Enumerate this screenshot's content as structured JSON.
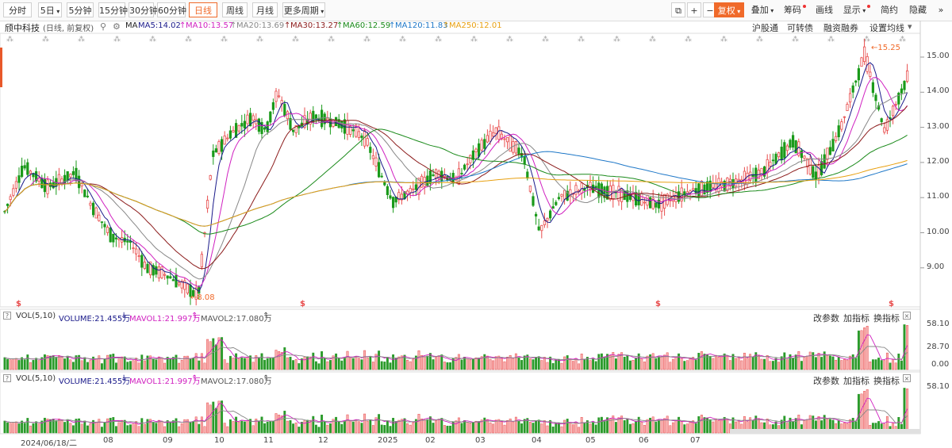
{
  "toolbar": {
    "periods": [
      {
        "label": "分时",
        "active": false
      },
      {
        "label": "5日",
        "active": false,
        "dropdown": true
      },
      {
        "label": "5分钟",
        "active": false
      },
      {
        "label": "15分钟",
        "active": false
      },
      {
        "label": "30分钟",
        "active": false
      },
      {
        "label": "60分钟",
        "active": false
      },
      {
        "label": "日线",
        "active": true
      },
      {
        "label": "周线",
        "active": false
      },
      {
        "label": "月线",
        "active": false
      },
      {
        "label": "更多周期",
        "active": false,
        "dropdown": true
      }
    ],
    "right_buttons": [
      {
        "label": "复权",
        "style": "orange",
        "dropdown": true
      },
      {
        "label": "叠加",
        "dropdown": true
      },
      {
        "label": "筹码",
        "dot": true
      },
      {
        "label": "画线"
      },
      {
        "label": "显示",
        "dropdown": true,
        "dot": true
      },
      {
        "label": "简约"
      },
      {
        "label": "隐藏"
      }
    ]
  },
  "header": {
    "stock_name": "颀中科技",
    "mode": "(日线, 前复权)",
    "ma_label": "MA",
    "ma": [
      {
        "label": "MA5:14.02",
        "color": "#1a1a8a"
      },
      {
        "label": "MA10:13.57",
        "color": "#d020c0"
      },
      {
        "label": "MA20:13.69",
        "color": "#888888"
      },
      {
        "label": "MA30:13.27",
        "color": "#8b1a1a"
      },
      {
        "label": "MA60:12.59",
        "color": "#1a8a1a"
      },
      {
        "label": "MA120:11.83",
        "color": "#1f78c8"
      },
      {
        "label": "MA250:12.01",
        "color": "#e8a010"
      }
    ],
    "links": [
      "沪股通",
      "可转债",
      "融资融券",
      "设置均线"
    ]
  },
  "price_axis": [
    "15.00",
    "14.00",
    "13.00",
    "12.00",
    "11.00",
    "10.00",
    "9.00"
  ],
  "high_label": "15.25",
  "low_label": "8.08",
  "vol_panel": {
    "title": "VOL(5,10)",
    "volume": "VOLUME:21.455万",
    "mavol1": "MAVOL1:21.997万",
    "mavol2": "MAVOL2:17.080万",
    "actions": [
      "改参数",
      "加指标",
      "换指标"
    ],
    "axis": [
      "58.10",
      "28.70",
      "0.00"
    ]
  },
  "vol_panel2": {
    "title": "VOL(5,10)",
    "volume": "VOLUME:21.455万",
    "mavol1": "MAVOL1:21.997万",
    "mavol2": "MAVOL2:17.080万",
    "actions": [
      "改参数",
      "加指标",
      "换指标"
    ],
    "axis": [
      "58.10"
    ]
  },
  "date_axis": [
    "2024/06/18/二",
    "08",
    "09",
    "10",
    "11",
    "12",
    "2025",
    "02",
    "03",
    "04",
    "05",
    "06",
    "07"
  ],
  "colors": {
    "up": "#e84c4c",
    "down": "#1a9a1a",
    "accent": "#f06a2a"
  },
  "chart_data": {
    "type": "candlestick",
    "series": [
      {
        "name": "MA5",
        "values": [
          14.02
        ]
      },
      {
        "name": "MA10",
        "values": [
          13.57
        ]
      },
      {
        "name": "MA20",
        "values": [
          13.69
        ]
      },
      {
        "name": "MA30",
        "values": [
          13.27
        ]
      },
      {
        "name": "MA60",
        "values": [
          12.59
        ]
      },
      {
        "name": "MA120",
        "values": [
          11.83
        ]
      },
      {
        "name": "MA250",
        "values": [
          12.01
        ]
      }
    ],
    "ylim": [
      8.0,
      15.3
    ],
    "high": 15.25,
    "low": 8.08,
    "close_path": [
      [
        "2024-06-18",
        10.6
      ],
      [
        "2024-06-25",
        11.9
      ],
      [
        "2024-07-05",
        11.3
      ],
      [
        "2024-07-15",
        11.7
      ],
      [
        "2024-07-25",
        10.8
      ],
      [
        "2024-08-05",
        9.9
      ],
      [
        "2024-08-15",
        9.7
      ],
      [
        "2024-08-25",
        9.0
      ],
      [
        "2024-09-05",
        8.8
      ],
      [
        "2024-09-15",
        8.5
      ],
      [
        "2024-09-24",
        8.2
      ],
      [
        "2024-09-30",
        12.2
      ],
      [
        "2024-10-10",
        12.8
      ],
      [
        "2024-10-20",
        13.3
      ],
      [
        "2024-10-31",
        12.9
      ],
      [
        "2024-11-08",
        14.0
      ],
      [
        "2024-11-20",
        12.9
      ],
      [
        "2024-12-05",
        13.3
      ],
      [
        "2024-12-20",
        13.1
      ],
      [
        "2024-12-31",
        12.7
      ],
      [
        "2025-01-10",
        10.9
      ],
      [
        "2025-01-20",
        11.2
      ],
      [
        "2025-02-05",
        11.7
      ],
      [
        "2025-02-20",
        11.5
      ],
      [
        "2025-03-05",
        12.3
      ],
      [
        "2025-03-15",
        12.9
      ],
      [
        "2025-03-31",
        12.2
      ],
      [
        "2025-04-07",
        10.0
      ],
      [
        "2025-04-20",
        11.0
      ],
      [
        "2025-05-05",
        11.3
      ],
      [
        "2025-05-20",
        11.1
      ],
      [
        "2025-06-05",
        10.8
      ],
      [
        "2025-06-20",
        11.2
      ],
      [
        "2025-07-05",
        11.4
      ],
      [
        "2025-07-20",
        11.7
      ],
      [
        "2025-08-05",
        12.6
      ],
      [
        "2025-08-15",
        11.6
      ],
      [
        "2025-08-25",
        13.0
      ],
      [
        "2025-09-01",
        15.1
      ],
      [
        "2025-09-10",
        12.9
      ],
      [
        "2025-09-20",
        14.5
      ]
    ]
  }
}
